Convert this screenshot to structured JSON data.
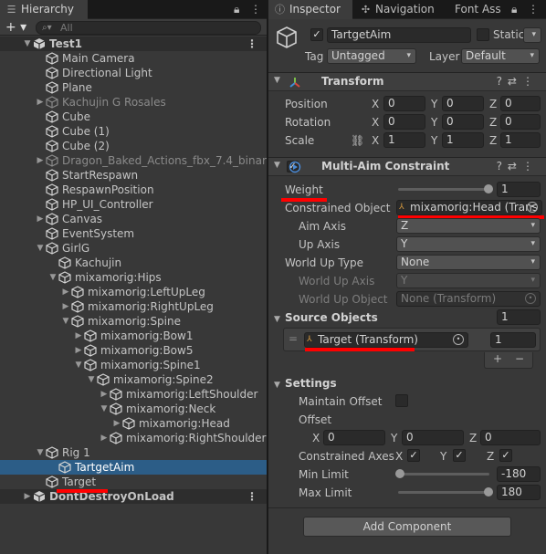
{
  "hierarchy": {
    "tab_label": "Hierarchy",
    "search_placeholder": "All",
    "rows": [
      {
        "label": "Test1"
      },
      {
        "label": "Main Camera"
      },
      {
        "label": "Directional Light"
      },
      {
        "label": "Plane"
      },
      {
        "label": "Kachujin G Rosales"
      },
      {
        "label": "Cube"
      },
      {
        "label": "Cube (1)"
      },
      {
        "label": "Cube (2)"
      },
      {
        "label": "Dragon_Baked_Actions_fbx_7.4_binar"
      },
      {
        "label": "StartRespawn"
      },
      {
        "label": "RespawnPosition"
      },
      {
        "label": "HP_UI_Controller"
      },
      {
        "label": "Canvas"
      },
      {
        "label": "EventSystem"
      },
      {
        "label": "GirlG"
      },
      {
        "label": "Kachujin"
      },
      {
        "label": "mixamorig:Hips"
      },
      {
        "label": "mixamorig:LeftUpLeg"
      },
      {
        "label": "mixamorig:RightUpLeg"
      },
      {
        "label": "mixamorig:Spine"
      },
      {
        "label": "mixamorig:Bow1"
      },
      {
        "label": "mixamorig:Bow5"
      },
      {
        "label": "mixamorig:Spine1"
      },
      {
        "label": "mixamorig:Spine2"
      },
      {
        "label": "mixamorig:LeftShoulder"
      },
      {
        "label": "mixamorig:Neck"
      },
      {
        "label": "mixamorig:Head"
      },
      {
        "label": "mixamorig:RightShoulder"
      },
      {
        "label": "Rig 1"
      },
      {
        "label": "TartgetAim"
      },
      {
        "label": "Target"
      },
      {
        "label": "DontDestroyOnLoad"
      }
    ]
  },
  "inspector": {
    "tabs": {
      "inspector": "Inspector",
      "navigation": "Navigation",
      "font": "Font Ass"
    },
    "object": {
      "name": "TartgetAim",
      "static_label": "Static",
      "tag_label": "Tag",
      "tag_value": "Untagged",
      "layer_label": "Layer",
      "layer_value": "Default"
    },
    "transform": {
      "title": "Transform",
      "rows": [
        {
          "label": "Position",
          "x": "0",
          "y": "0",
          "z": "0"
        },
        {
          "label": "Rotation",
          "x": "0",
          "y": "0",
          "z": "0"
        },
        {
          "label": "Scale",
          "x": "1",
          "y": "1",
          "z": "1"
        }
      ],
      "axis_x": "X",
      "axis_y": "Y",
      "axis_z": "Z"
    },
    "multiaim": {
      "title": "Multi-Aim Constraint",
      "weight_label": "Weight",
      "weight_value": "1",
      "constrained_label": "Constrained Object",
      "constrained_value": "mixamorig:Head (Trans",
      "aim_axis_label": "Aim Axis",
      "aim_axis_value": "Z",
      "up_axis_label": "Up Axis",
      "up_axis_value": "Y",
      "world_up_type_label": "World Up Type",
      "world_up_type_value": "None",
      "world_up_axis_label": "World Up Axis",
      "world_up_axis_value": "Y",
      "world_up_object_label": "World Up Object",
      "world_up_object_value": "None (Transform)",
      "source_objects_label": "Source Objects",
      "source_count": "1",
      "source_item": "Target (Transform)",
      "source_weight": "1",
      "plus": "+",
      "minus": "−",
      "settings_label": "Settings",
      "maintain_offset_label": "Maintain Offset",
      "offset_label": "Offset",
      "offset_x": "0",
      "offset_y": "0",
      "offset_z": "0",
      "constrained_axes_label": "Constrained Axes",
      "min_limit_label": "Min Limit",
      "min_limit_value": "-180",
      "max_limit_label": "Max Limit",
      "max_limit_value": "180"
    },
    "add_component": "Add Component"
  }
}
